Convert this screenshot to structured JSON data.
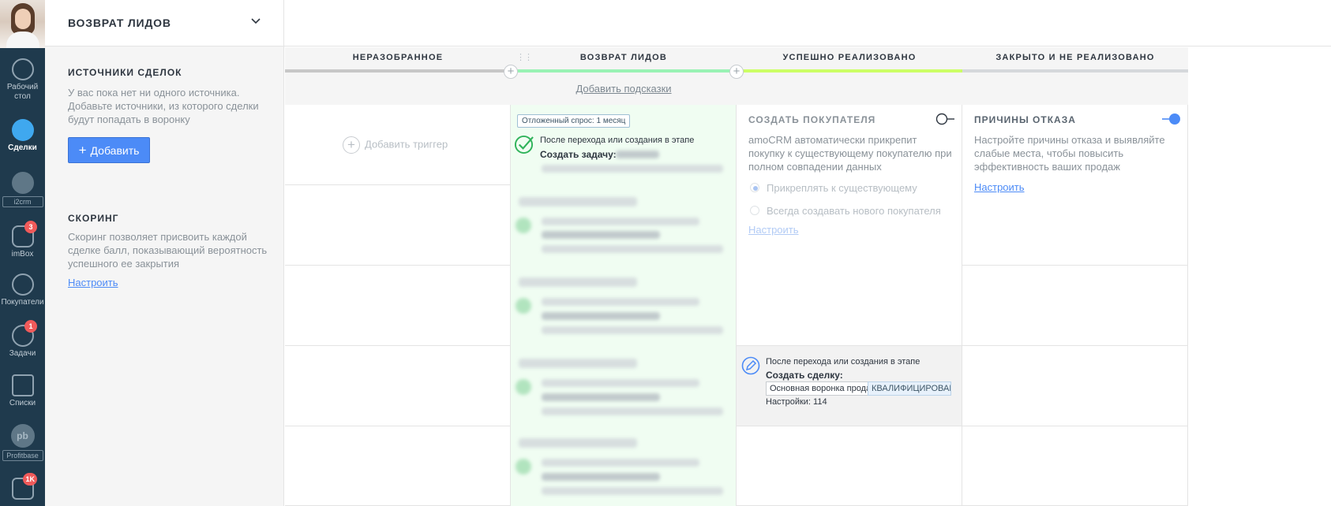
{
  "nav": {
    "items": [
      {
        "label": "Рабочий стол",
        "icon": "dashboard-icon"
      },
      {
        "label": "Сделки",
        "icon": "deals-icon"
      },
      {
        "label": "i2crm",
        "icon": "i2crm-icon"
      },
      {
        "label": "imBox",
        "icon": "chat-icon",
        "badge": "3"
      },
      {
        "label": "Покупатели",
        "icon": "customers-icon"
      },
      {
        "label": "Задачи",
        "icon": "tasks-icon",
        "badge": "1"
      },
      {
        "label": "Списки",
        "icon": "lists-icon"
      },
      {
        "label": "Profitbase",
        "icon": "profitbase-icon",
        "logo_text": "pb"
      },
      {
        "label": "",
        "icon": "mail-icon",
        "badge": "1K"
      }
    ]
  },
  "panel": {
    "title": "ВОЗВРАТ ЛИДОВ",
    "sources_title": "ИСТОЧНИКИ СДЕЛОК",
    "sources_text": "У вас пока нет ни одного источника. Добавьте источники, из которого сделки будут попадать в воронку",
    "add_button": "Добавить",
    "scoring_title": "СКОРИНГ",
    "scoring_text": "Скоринг позволяет присвоить каждой сделке балл, показывающий вероятность успешного ее закрытия",
    "scoring_link": "Настроить"
  },
  "columns": [
    {
      "title": "НЕРАЗОБРАННОЕ",
      "color": "#c7c7c7"
    },
    {
      "title": "ВОЗВРАТ ЛИДОВ",
      "color": "#99f2b4"
    },
    {
      "title": "УСПЕШНО РЕАЛИЗОВАНО",
      "color": "#ccff66"
    },
    {
      "title": "ЗАКРЫТО И НЕ РЕАЛИЗОВАНО",
      "color": "#d5d8db"
    }
  ],
  "hints_link": "Добавить подсказки",
  "add_trigger": "Добавить триггер",
  "trigger": {
    "tag": "Отложенный спрос: 1 месяц",
    "when": "После перехода или создания в этапе",
    "action": "Создать задачу:"
  },
  "buyer_card": {
    "title": "СОЗДАТЬ ПОКУПАТЕЛЯ",
    "text": "amoCRM автоматически прикрепит покупку к существующему покупателю при полном совпадении данных",
    "option1": "Прикреплять к существующему",
    "option2": "Всегда создавать нового покупателя",
    "link": "Настроить"
  },
  "refusal_card": {
    "title": "ПРИЧИНЫ ОТКАЗА",
    "text": "Настройте причины отказа и выявляйте слабые места, чтобы повысить эффективность ваших продаж",
    "link": "Настроить"
  },
  "deal_trigger": {
    "when": "После перехода или создания в этапе",
    "action": "Создать сделку:",
    "pipeline": "Основная воронка продаж",
    "status": "КВАЛИФИЦИРОВАН",
    "settings": "Настройки: 114"
  },
  "colors": {
    "accent": "#4c8bf7",
    "nav_bg": "#1f3a4d",
    "badge": "#f05a5a",
    "green_column": "#f0fdf2"
  }
}
